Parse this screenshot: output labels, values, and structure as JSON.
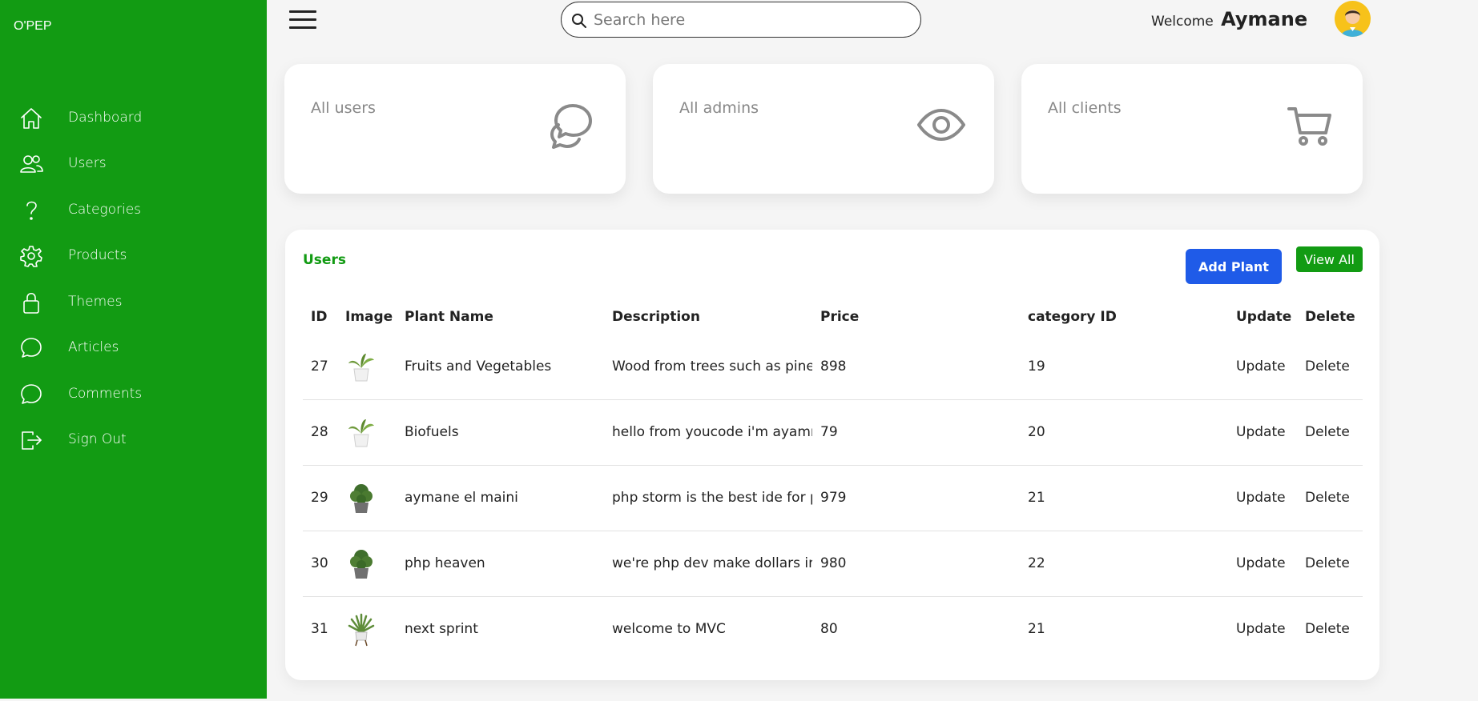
{
  "sidebar": {
    "brand": "O'PEP",
    "items": [
      {
        "label": "Dashboard",
        "icon": "home-icon"
      },
      {
        "label": "Users",
        "icon": "users-icon"
      },
      {
        "label": "Categories",
        "icon": "question-icon"
      },
      {
        "label": "Products",
        "icon": "gear-icon"
      },
      {
        "label": "Themes",
        "icon": "lock-icon"
      },
      {
        "label": "Articles",
        "icon": "chat-icon"
      },
      {
        "label": "Comments",
        "icon": "chat-icon"
      },
      {
        "label": "Sign Out",
        "icon": "sign-out-icon"
      }
    ]
  },
  "topbar": {
    "search_placeholder": "Search here",
    "welcome_text": "Welcome",
    "user_name": "Aymane"
  },
  "cards": [
    {
      "label": "All users",
      "icon": "chatbubbles-icon"
    },
    {
      "label": "All admins",
      "icon": "eye-icon"
    },
    {
      "label": "All clients",
      "icon": "cart-icon"
    }
  ],
  "panel": {
    "title": "Users",
    "add_button": "Add Plant",
    "view_button": "View All",
    "columns": [
      "ID",
      "Image",
      "Plant Name",
      "Description",
      "Price",
      "category ID",
      "Update",
      "Delete"
    ],
    "rows": [
      {
        "id": "27",
        "name": "Fruits and Vegetables",
        "description": "Wood from trees such as pine",
        "price": "898",
        "category": "19",
        "update": "Update",
        "delete": "Delete"
      },
      {
        "id": "28",
        "name": "Biofuels",
        "description": "hello from youcode i'm ayamr",
        "price": "79",
        "category": "20",
        "update": "Update",
        "delete": "Delete"
      },
      {
        "id": "29",
        "name": "aymane el maini",
        "description": "php storm is the best ide for p",
        "price": "979",
        "category": "21",
        "update": "Update",
        "delete": "Delete"
      },
      {
        "id": "30",
        "name": "php heaven",
        "description": "we're php dev make dollars in",
        "price": "980",
        "category": "22",
        "update": "Update",
        "delete": "Delete"
      },
      {
        "id": "31",
        "name": "next sprint",
        "description": "welcome to MVC",
        "price": "80",
        "category": "21",
        "update": "Update",
        "delete": "Delete"
      }
    ]
  },
  "colors": {
    "sidebar": "#129b13",
    "add_button": "#1f5be8",
    "view_button": "#129b13",
    "avatar": "#f7c21a"
  }
}
